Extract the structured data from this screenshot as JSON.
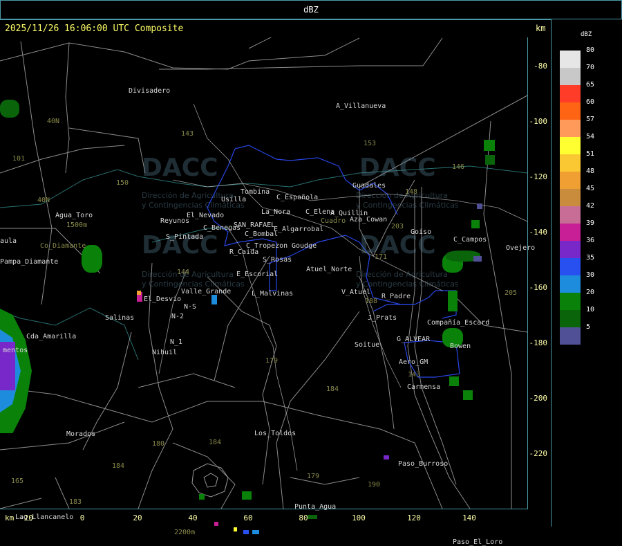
{
  "header": {
    "title": "dBZ"
  },
  "timestamp": "2025/11/26 16:06:00 UTC Composite",
  "axis": {
    "unit": "km",
    "y_ticks": [
      "-80",
      "-100",
      "-120",
      "-140",
      "-160",
      "-180",
      "-200",
      "-220"
    ],
    "x_ticks": [
      "-20",
      "0",
      "20",
      "40",
      "60",
      "80",
      "100",
      "120",
      "140"
    ]
  },
  "legend": {
    "title": "dBZ",
    "items": [
      {
        "label": "80",
        "color": "#e6e6e6"
      },
      {
        "label": "70",
        "color": "#c8c8c8"
      },
      {
        "label": "65",
        "color": "#ff3c28"
      },
      {
        "label": "60",
        "color": "#ff6414"
      },
      {
        "label": "57",
        "color": "#ff9a5a"
      },
      {
        "label": "54",
        "color": "#ffff32"
      },
      {
        "label": "51",
        "color": "#fac832"
      },
      {
        "label": "48",
        "color": "#f0a032"
      },
      {
        "label": "45",
        "color": "#c88c3c"
      },
      {
        "label": "42",
        "color": "#c86e96"
      },
      {
        "label": "39",
        "color": "#c81e96"
      },
      {
        "label": "36",
        "color": "#7828c8"
      },
      {
        "label": "35",
        "color": "#2850f0"
      },
      {
        "label": "30",
        "color": "#1e8cdc"
      },
      {
        "label": "20",
        "color": "#0a820a"
      },
      {
        "label": "10",
        "color": "#0a640a"
      },
      {
        "label": "5",
        "color": "#505096"
      }
    ]
  },
  "watermark": {
    "brand": "DACC",
    "line1": "Dirección de Agricultura",
    "line2": "y Contingencias Climáticas"
  },
  "places": [
    "Divisadero",
    "A_Villanueva",
    "40N",
    "101",
    "150",
    "Tombina",
    "Usilla",
    "C_Española",
    "La_Nora",
    "Guadales",
    "40N",
    "Agua_Toro",
    "1500m",
    "C_Elena",
    "Cuadro",
    "Reyunos",
    "El_Nevado",
    "A_Quillin",
    "Aza_Cowan",
    "SAN_RAFAEL",
    "C_Benegas",
    "E_Algarrobal",
    "Goiso",
    "C_Campos",
    "Ovejero",
    "aula",
    "Co_Diamante",
    "S_Pintada",
    "C_Bombal",
    "R_Caida",
    "C_Tropezon",
    "Goudge",
    "Pampa_Diamante",
    "S_Rosas",
    "Atuel_Norte",
    "E_Escorial",
    "Valle_Grande",
    "L_Malvinas",
    "V_Atuel",
    "R_Padre",
    "El_Desvio",
    "N-S",
    "Salinas",
    "N-2",
    "J_Prats",
    "Compañía_Escard",
    "Cda_Amarilla",
    "N_1",
    "G_ALVEAR",
    "Bowen",
    "mentos",
    "Nihuil",
    "Soitue",
    "Aero_GM",
    "Carmensa",
    "Morados",
    "Los_Toldos",
    "Paso_Burroso",
    "Punta_Agua",
    "Lag_Llancanelo",
    "2200m",
    "Paso_El_Loro"
  ],
  "routes": [
    "143",
    "153",
    "146",
    "148",
    "179",
    "184",
    "180",
    "184",
    "183",
    "179",
    "190",
    "203",
    "171",
    "188",
    "205",
    "143",
    "184",
    "165",
    "144"
  ]
}
